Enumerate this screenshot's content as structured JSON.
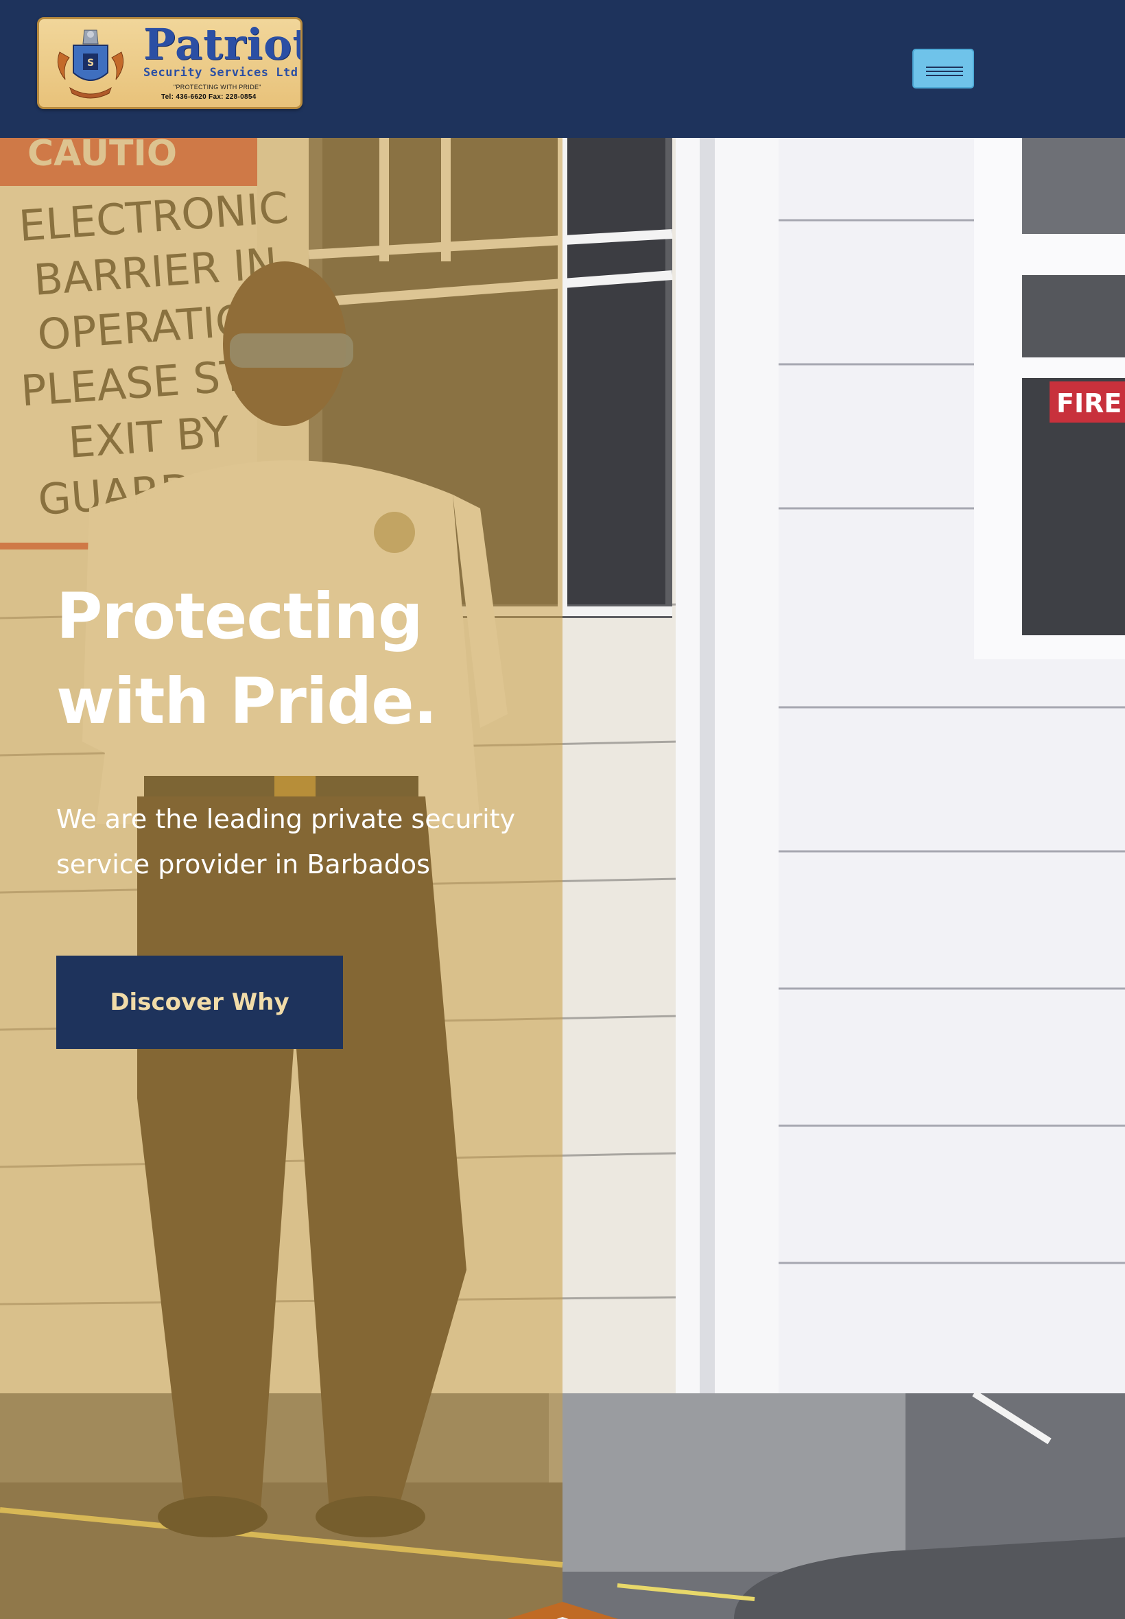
{
  "header": {
    "logo": {
      "name": "Patriot",
      "subtitle": "Security Services Ltd",
      "tagline": "\"PROTECTING WITH PRIDE\"",
      "contact": "Tel: 436-6620    Fax: 228-0854"
    },
    "menu_icon": "hamburger-icon"
  },
  "hero": {
    "title": "Protecting\nwith Pride.",
    "subtitle": "We are the leading private security service provider in Barbados",
    "cta_label": "Discover Why",
    "sign_text": [
      "CAUTION",
      "ELECTRONIC",
      "BARRIER IN",
      "OPERATION",
      "PLEASE STOP.",
      "EXIT BY",
      "GUARD"
    ],
    "fire_sign": "FIRE"
  },
  "colors": {
    "navy": "#1e335c",
    "menu_blue": "#6fc3ea",
    "overlay_gold": "#cb9e46",
    "cta_text": "#f1dca9",
    "logo_blue": "#2b4fa4"
  }
}
